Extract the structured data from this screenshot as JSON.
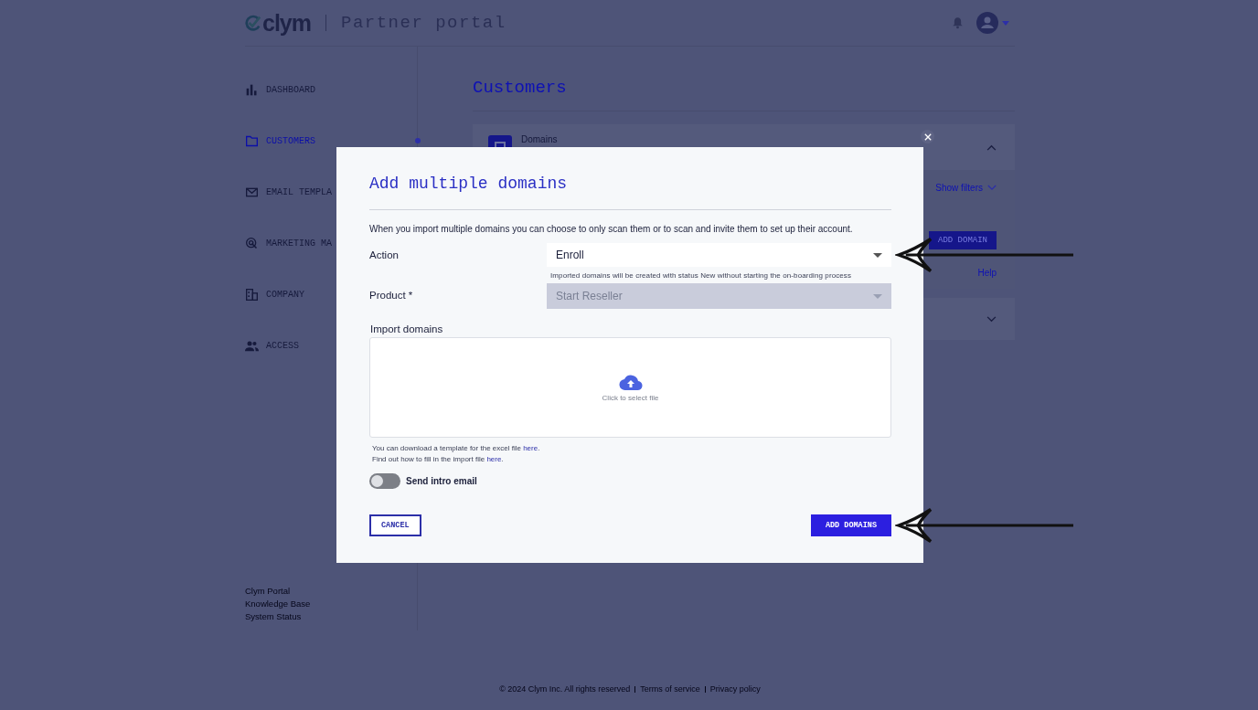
{
  "header": {
    "logo": "clym",
    "portal_title": "Partner portal"
  },
  "sidebar": {
    "items": [
      {
        "label": "DASHBOARD",
        "selected": false
      },
      {
        "label": "CUSTOMERS",
        "selected": true
      },
      {
        "label": "EMAIL TEMPLA",
        "selected": false
      },
      {
        "label": "MARKETING MA",
        "selected": false
      },
      {
        "label": "COMPANY",
        "selected": false
      },
      {
        "label": "ACCESS",
        "selected": false
      }
    ],
    "links": [
      "Clym Portal",
      "Knowledge Base",
      "System Status"
    ]
  },
  "main": {
    "title": "Customers",
    "domains_panel": {
      "title": "Domains",
      "expanded": true,
      "show_filters": "Show filters",
      "add_button": "ADD DOMAIN",
      "help": "Help"
    },
    "second_panel": {
      "expanded": false
    }
  },
  "modal": {
    "title": "Add multiple domains",
    "description": "When you import multiple domains you can choose to only scan them or to scan and invite them to set up their account.",
    "action": {
      "label": "Action",
      "value": "Enroll",
      "hint": "Imported domains will be created with status New without starting the on-boarding process",
      "disabled": false,
      "callout": true
    },
    "product": {
      "label": "Product *",
      "value": "Start Reseller",
      "disabled": true
    },
    "import": {
      "label": "Import domains",
      "prompt": "Click to select file"
    },
    "notes": [
      {
        "text": "You can download a template for the excel file ",
        "link": "here",
        "end": "."
      },
      {
        "text": "Find out how to fill in the import file  ",
        "link": "here",
        "end": "."
      }
    ],
    "toggle": {
      "label": "Send intro email",
      "on": false
    },
    "cancel": {
      "label": "CANCEL"
    },
    "submit": {
      "label": "ADD DOMAINS",
      "callout": true
    }
  },
  "footer": {
    "copyright": "© 2024 Clym Inc. All rights reserved",
    "links": [
      "Terms of service",
      "Privacy policy"
    ]
  }
}
